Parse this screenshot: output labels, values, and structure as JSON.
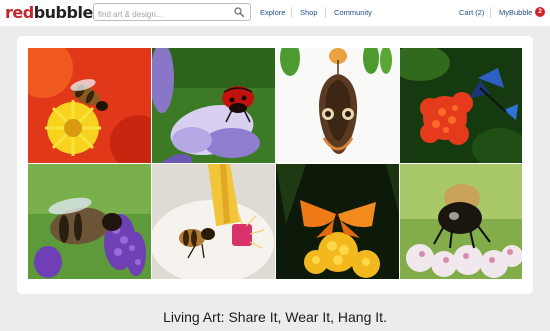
{
  "header": {
    "logo_red": "red",
    "logo_dark": "bubble",
    "search_placeholder": "find art & design...",
    "nav": {
      "explore": "Explore",
      "shop": "Shop",
      "community": "Community",
      "cart": "Cart (2)",
      "mybubble": "MyBubble",
      "notification_count": "2"
    }
  },
  "gallery": {
    "tiles": [
      {
        "subject": "bee-on-orange-flower"
      },
      {
        "subject": "ladybird-on-purple-flower"
      },
      {
        "subject": "butterfly-hanging"
      },
      {
        "subject": "butterfly-on-red-flower"
      },
      {
        "subject": "bee-on-lavender"
      },
      {
        "subject": "bee-on-white-flower"
      },
      {
        "subject": "orange-butterfly-on-yellow-flower"
      },
      {
        "subject": "bumblebee-on-white-flowers"
      }
    ]
  },
  "tagline": "Living Art: Share It, Wear It, Hang It.",
  "colors": {
    "brand_red": "#c2272d",
    "link_blue": "#23508c",
    "background": "#ececec"
  }
}
